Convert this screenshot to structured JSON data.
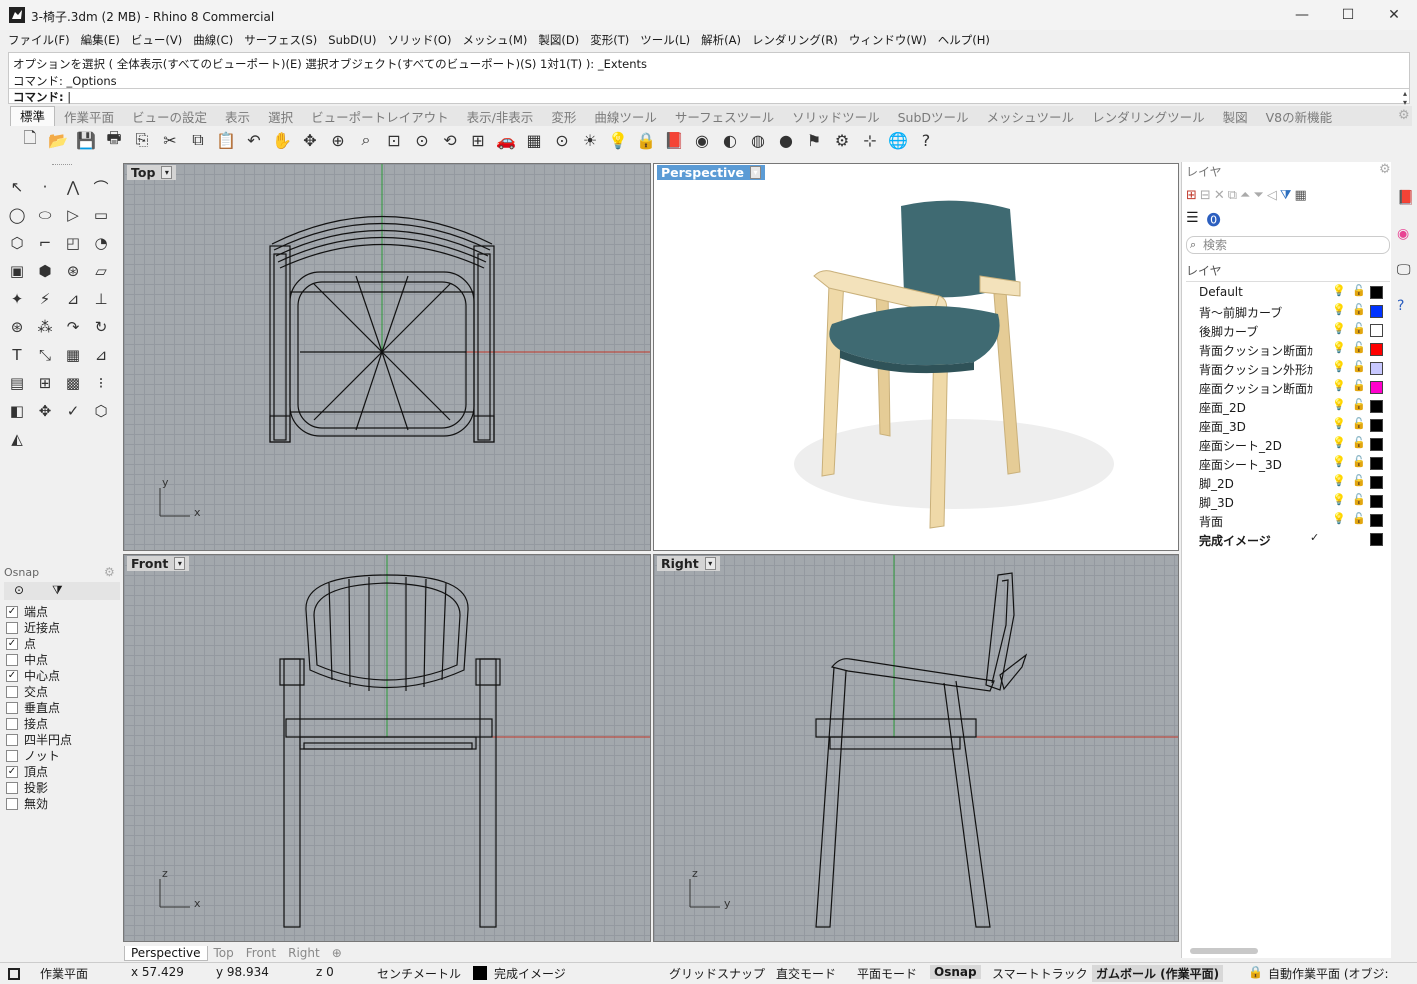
{
  "window": {
    "title": "3-椅子.3dm (2 MB) - Rhino 8 Commercial",
    "minimize": "—",
    "maximize": "☐",
    "close": "✕"
  },
  "menu": [
    "ファイル(F)",
    "編集(E)",
    "ビュー(V)",
    "曲線(C)",
    "サーフェス(S)",
    "SubD(U)",
    "ソリッド(O)",
    "メッシュ(M)",
    "製図(D)",
    "変形(T)",
    "ツール(L)",
    "解析(A)",
    "レンダリング(R)",
    "ウィンドウ(W)",
    "ヘルプ(H)"
  ],
  "command": {
    "history1": "オプションを選択 ( 全体表示(すべてのビューポート)(E)  選択オブジェクト(すべてのビューポート)(S)  1対1(T) ): _Extents",
    "history2": "コマンド: _Options",
    "prompt": "コマンド:"
  },
  "toolbar_tabs": [
    "標準",
    "作業平面",
    "ビューの設定",
    "表示",
    "選択",
    "ビューポートレイアウト",
    "表示/非表示",
    "変形",
    "曲線ツール",
    "サーフェスツール",
    "ソリッドツール",
    "SubDツール",
    "メッシュツール",
    "レンダリングツール",
    "製図",
    "V8の新機能"
  ],
  "toolbar_icons": [
    "new-icon",
    "open-icon",
    "save-icon",
    "print-icon",
    "import-icon",
    "cut-icon",
    "copy-icon",
    "paste-icon",
    "undo-icon",
    "pan-icon",
    "rotate-view-icon",
    "zoom-icon",
    "zoom-window-icon",
    "zoom-extents-icon",
    "zoom-selected-icon",
    "rotate-icon",
    "viewport-layout-icon",
    "car-icon",
    "grid-icon",
    "point-icon",
    "snap-icon",
    "light-bulb-icon",
    "lock-icon",
    "layer-icon",
    "color-wheel-icon",
    "material-icon",
    "sphere-wire-icon",
    "sphere-render-icon",
    "flag-icon",
    "settings-gear-icon",
    "dimension-icon",
    "globe-icon",
    "help-icon"
  ],
  "toolbar_glyphs": [
    "🗋",
    "📂",
    "💾",
    "🖶",
    "⎘",
    "✂",
    "⧉",
    "📋",
    "↶",
    "✋",
    "✥",
    "⊕",
    "⌕",
    "⊡",
    "⊙",
    "⟲",
    "⊞",
    "🚗",
    "▦",
    "⊙",
    "☀",
    "💡",
    "🔒",
    "📕",
    "◉",
    "◐",
    "◍",
    "●",
    "⚑",
    "⚙",
    "⊹",
    "🌐",
    "?"
  ],
  "left_tools": [
    "↖",
    "·",
    "⋀",
    "⌒",
    "◯",
    "⬭",
    "▷",
    "▭",
    "⬡",
    "⌐",
    "◰",
    "◔",
    "▣",
    "⬢",
    "⊛",
    "▱",
    "✦",
    "⚡",
    "⊿",
    "⊥",
    "⊛",
    "⁂",
    "↷",
    "↻",
    "T",
    "⤡",
    "▦",
    "⊿",
    "▤",
    "⊞",
    "▩",
    "⁝",
    "◧",
    "✥",
    "✓",
    "⬡",
    "◭"
  ],
  "osnap": {
    "title": "Osnap",
    "items": [
      {
        "label": "端点",
        "checked": true
      },
      {
        "label": "近接点",
        "checked": false
      },
      {
        "label": "点",
        "checked": true
      },
      {
        "label": "中点",
        "checked": false
      },
      {
        "label": "中心点",
        "checked": true
      },
      {
        "label": "交点",
        "checked": false
      },
      {
        "label": "垂直点",
        "checked": false
      },
      {
        "label": "接点",
        "checked": false
      },
      {
        "label": "四半円点",
        "checked": false
      },
      {
        "label": "ノット",
        "checked": false
      },
      {
        "label": "頂点",
        "checked": true
      },
      {
        "label": "投影",
        "checked": false
      },
      {
        "label": "無効",
        "checked": false
      }
    ]
  },
  "viewports": {
    "top": {
      "label": "Top",
      "axis1": "x",
      "axis2": "y"
    },
    "perspective": {
      "label": "Perspective"
    },
    "front": {
      "label": "Front",
      "axis1": "x",
      "axis2": "z"
    },
    "right": {
      "label": "Right",
      "axis1": "y",
      "axis2": "z"
    }
  },
  "viewport_tabs": [
    "Perspective",
    "Top",
    "Front",
    "Right"
  ],
  "viewport_tab_add": "⊕",
  "layers": {
    "title": "レイヤ",
    "search_placeholder": "検索",
    "header": "レイヤ",
    "rows": [
      {
        "name": "Default",
        "color": "#000000",
        "current": false
      },
      {
        "name": "背～前脚カーブ",
        "color": "#0033ff",
        "current": false
      },
      {
        "name": "後脚カーブ",
        "color": "#ffffff",
        "current": false
      },
      {
        "name": "背面クッション断面ｶ",
        "color": "#ff0000",
        "current": false
      },
      {
        "name": "背面クッション外形ｶ",
        "color": "#c8c8ff",
        "current": false
      },
      {
        "name": "座面クッション断面ｶ",
        "color": "#ff00cc",
        "current": false
      },
      {
        "name": "座面_2D",
        "color": "#000000",
        "current": false
      },
      {
        "name": "座面_3D",
        "color": "#000000",
        "current": false
      },
      {
        "name": "座面シート_2D",
        "color": "#000000",
        "current": false
      },
      {
        "name": "座面シート_3D",
        "color": "#000000",
        "current": false
      },
      {
        "name": "脚_2D",
        "color": "#000000",
        "current": false
      },
      {
        "name": "脚_3D",
        "color": "#000000",
        "current": false
      },
      {
        "name": "背面",
        "color": "#000000",
        "current": false
      },
      {
        "name": "完成イメージ",
        "color": "#000000",
        "current": true
      }
    ]
  },
  "status": {
    "cplane": "作業平面",
    "x": "x 57.429",
    "y": "y 98.934",
    "z": "z 0",
    "units": "センチメートル",
    "layer": "完成イメージ",
    "grid_snap": "グリッドスナップ",
    "ortho": "直交モード",
    "planar": "平面モード",
    "osnap": "Osnap",
    "smart_track": "スマートトラック",
    "gumball": "ガムボール (作業平面)",
    "auto_cplane": "自動作業平面 (オブジ:"
  },
  "colors": {
    "accent": "#5b9bd5",
    "seat": "#3f6a72",
    "wood": "#efd9a8",
    "x_axis": "#c0392b",
    "y_axis": "#2e9c3a"
  }
}
